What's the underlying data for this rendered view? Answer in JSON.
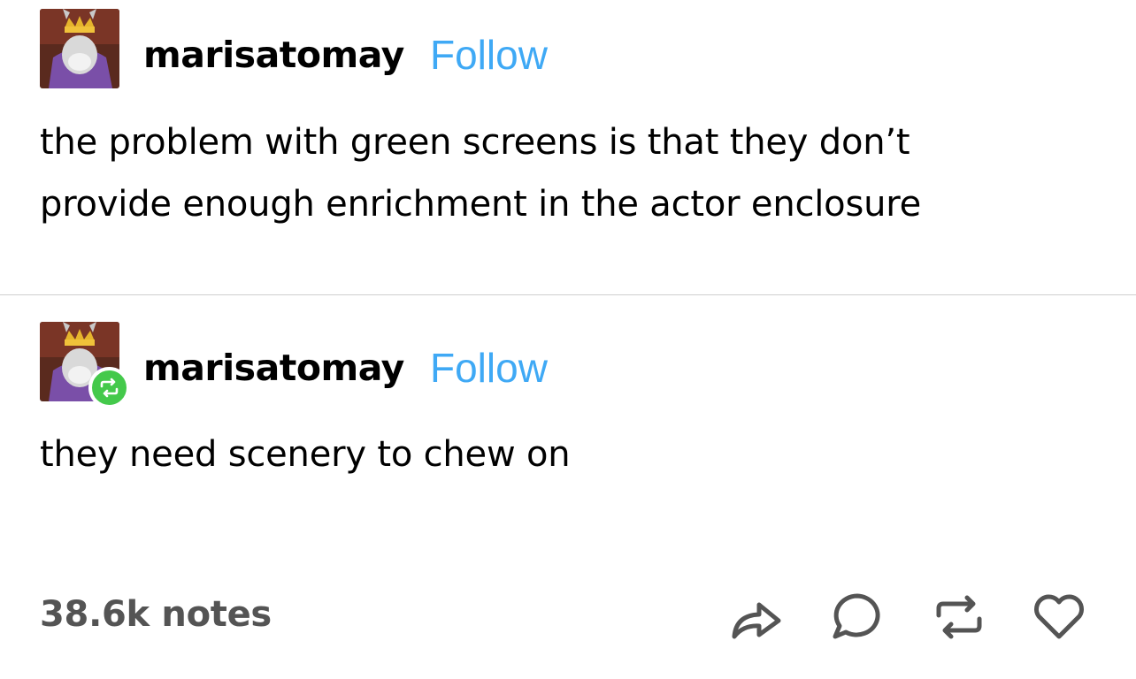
{
  "post": {
    "username": "marisatomay",
    "follow_label": "Follow",
    "body": "the problem with green screens is that they don’t provide enough enrichment in the actor enclosure"
  },
  "reply": {
    "username": "marisatomay",
    "follow_label": "Follow",
    "body": "they need scenery to chew on"
  },
  "footer": {
    "notes": "38.6k notes",
    "actions": [
      "share-icon",
      "comment-icon",
      "reblog-icon",
      "heart-icon"
    ]
  },
  "colors": {
    "follow": "#3fa9f5",
    "reblog_badge": "#44c94b",
    "notes_text": "#545454",
    "divider": "#cfcfcf"
  }
}
